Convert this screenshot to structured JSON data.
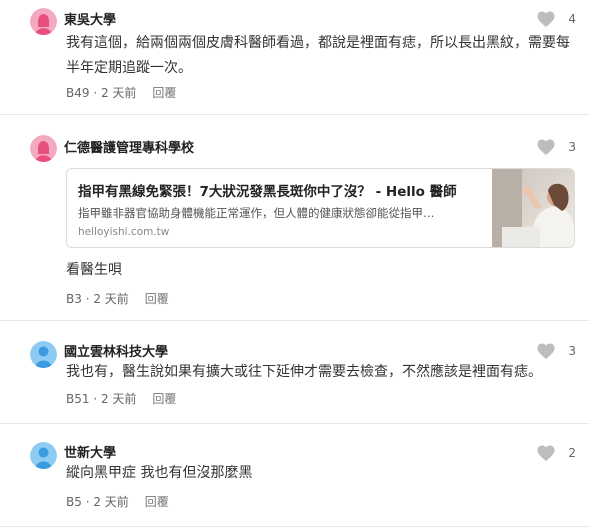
{
  "colors": {
    "avatar_pink": "#e84f7d",
    "avatar_blue": "#3a9be0",
    "heart_gray": "#bdbdbd"
  },
  "comments": [
    {
      "school": "東吳大學",
      "avatar": "pink",
      "likes": "4",
      "text": "我有這個，給兩個兩個皮膚科醫師看過，都說是裡面有痣，所以長出黑紋，需要每半年定期追蹤一次。",
      "floor": "B49",
      "time": "2 天前",
      "reply": "回覆"
    },
    {
      "school": "仁德醫護管理專科學校",
      "avatar": "pink",
      "likes": "3",
      "link": {
        "title": "指甲有黑線免緊張！7大狀況發黑長斑你中了沒？ - Hello 醫師",
        "description": "指甲雖非器官協助身體機能正常運作，但人體的健康狀態卻能從指甲…",
        "domain": "helloyishi.com.tw"
      },
      "text": "看醫生唄",
      "floor": "B3",
      "time": "2 天前",
      "reply": "回覆"
    },
    {
      "school": "國立雲林科技大學",
      "avatar": "blue",
      "likes": "3",
      "text": "我也有，醫生說如果有擴大或往下延伸才需要去檢查，不然應該是裡面有痣。",
      "floor": "B51",
      "time": "2 天前",
      "reply": "回覆"
    },
    {
      "school": "世新大學",
      "avatar": "blue",
      "likes": "2",
      "text": "縱向黑甲症 我也有但沒那麼黑",
      "floor": "B5",
      "time": "2 天前",
      "reply": "回覆"
    }
  ]
}
